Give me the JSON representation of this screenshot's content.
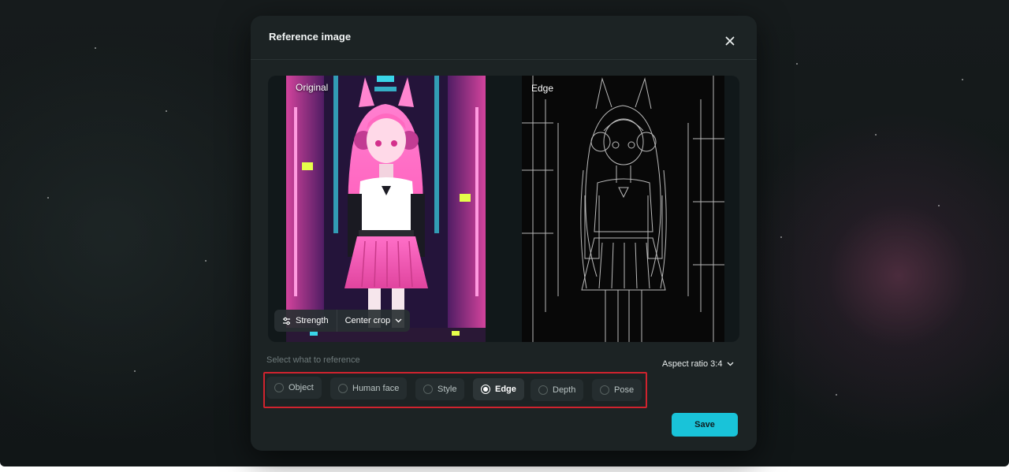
{
  "dialog": {
    "title": "Reference image",
    "close_icon": "close-icon"
  },
  "preview": {
    "original_label": "Original",
    "edge_label": "Edge",
    "strength_label": "Strength",
    "crop_label": "Center crop"
  },
  "reference": {
    "section_label": "Select what to reference",
    "aspect_label": "Aspect ratio 3:4",
    "selected": "Edge",
    "options": [
      {
        "label": "Object"
      },
      {
        "label": "Human face"
      },
      {
        "label": "Style"
      },
      {
        "label": "Edge"
      },
      {
        "label": "Depth"
      },
      {
        "label": "Pose"
      }
    ]
  },
  "actions": {
    "save_label": "Save"
  },
  "colors": {
    "accent": "#19c3d9",
    "highlight_outline": "#d0232e",
    "modal_bg": "#1c2324"
  }
}
